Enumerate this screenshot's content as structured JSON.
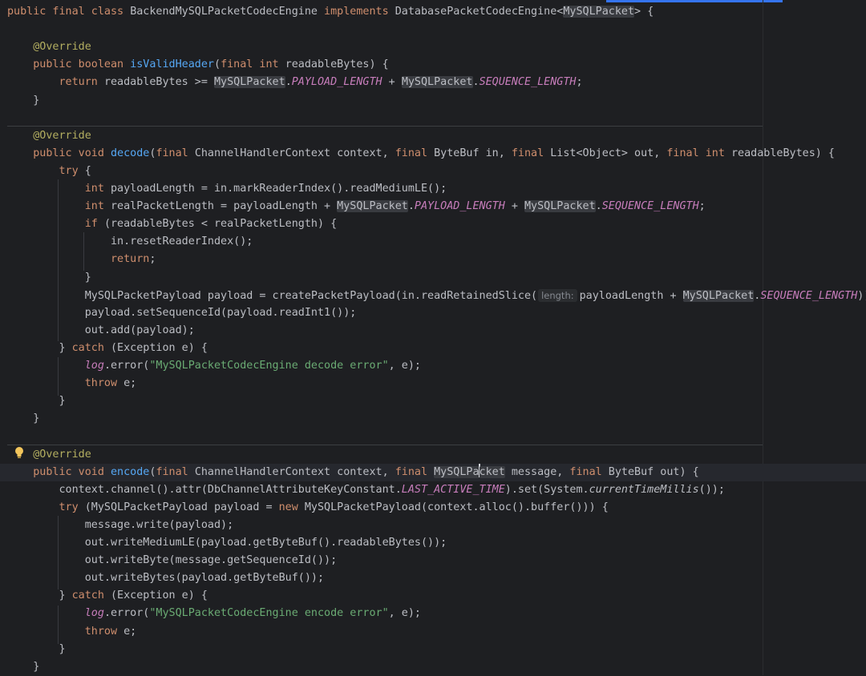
{
  "lines": [
    [
      {
        "t": "public final class ",
        "c": "kw"
      },
      {
        "t": "BackendMySQLPacketCodecEngine "
      },
      {
        "t": "implements ",
        "c": "kw"
      },
      {
        "t": "DatabasePacketCodecEngine<"
      },
      {
        "t": "MySQLPacket",
        "c": "ref"
      },
      {
        "t": "> {"
      }
    ],
    [],
    [
      {
        "t": "    "
      },
      {
        "t": "@Override",
        "c": "an"
      }
    ],
    [
      {
        "t": "    "
      },
      {
        "t": "public boolean ",
        "c": "kw"
      },
      {
        "t": "isValidHeader",
        "c": "fn"
      },
      {
        "t": "("
      },
      {
        "t": "final int ",
        "c": "kw"
      },
      {
        "t": "readableBytes) {"
      }
    ],
    [
      {
        "t": "        "
      },
      {
        "t": "return ",
        "c": "kw"
      },
      {
        "t": "readableBytes >= "
      },
      {
        "t": "MySQLPacket",
        "c": "ref"
      },
      {
        "t": "."
      },
      {
        "t": "PAYLOAD_LENGTH",
        "c": "cs"
      },
      {
        "t": " + "
      },
      {
        "t": "MySQLPacket",
        "c": "ref"
      },
      {
        "t": "."
      },
      {
        "t": "SEQUENCE_LENGTH",
        "c": "cs"
      },
      {
        "t": ";"
      }
    ],
    [
      {
        "t": "    }"
      }
    ],
    [],
    [
      {
        "t": "    "
      },
      {
        "t": "@Override",
        "c": "an"
      }
    ],
    [
      {
        "t": "    "
      },
      {
        "t": "public void ",
        "c": "kw"
      },
      {
        "t": "decode",
        "c": "fn"
      },
      {
        "t": "("
      },
      {
        "t": "final ",
        "c": "kw"
      },
      {
        "t": "ChannelHandlerContext context, "
      },
      {
        "t": "final ",
        "c": "kw"
      },
      {
        "t": "ByteBuf in, "
      },
      {
        "t": "final ",
        "c": "kw"
      },
      {
        "t": "List<Object> out, "
      },
      {
        "t": "final int ",
        "c": "kw"
      },
      {
        "t": "readableBytes) {"
      }
    ],
    [
      {
        "t": "        "
      },
      {
        "t": "try ",
        "c": "kw"
      },
      {
        "t": "{"
      }
    ],
    [
      {
        "t": "            "
      },
      {
        "t": "int ",
        "c": "kw"
      },
      {
        "t": "payloadLength = in.markReaderIndex().readMediumLE();"
      }
    ],
    [
      {
        "t": "            "
      },
      {
        "t": "int ",
        "c": "kw"
      },
      {
        "t": "realPacketLength = payloadLength + "
      },
      {
        "t": "MySQLPacket",
        "c": "ref"
      },
      {
        "t": "."
      },
      {
        "t": "PAYLOAD_LENGTH",
        "c": "cs"
      },
      {
        "t": " + "
      },
      {
        "t": "MySQLPacket",
        "c": "ref"
      },
      {
        "t": "."
      },
      {
        "t": "SEQUENCE_LENGTH",
        "c": "cs"
      },
      {
        "t": ";"
      }
    ],
    [
      {
        "t": "            "
      },
      {
        "t": "if ",
        "c": "kw"
      },
      {
        "t": "(readableBytes < realPacketLength) {"
      }
    ],
    [
      {
        "t": "                in.resetReaderIndex();"
      }
    ],
    [
      {
        "t": "                "
      },
      {
        "t": "return",
        "c": "kw"
      },
      {
        "t": ";"
      }
    ],
    [
      {
        "t": "            }"
      }
    ],
    [
      {
        "t": "            MySQLPacketPayload payload = createPacketPayload(in.readRetainedSlice("
      },
      {
        "t": "length:",
        "c": "hint"
      },
      {
        "t": "payloadLength + "
      },
      {
        "t": "MySQLPacket",
        "c": "ref"
      },
      {
        "t": "."
      },
      {
        "t": "SEQUENCE_LENGTH",
        "c": "cs"
      },
      {
        "t": "));"
      }
    ],
    [
      {
        "t": "            payload.setSequenceId(payload.readInt1());"
      }
    ],
    [
      {
        "t": "            out.add(payload);"
      }
    ],
    [
      {
        "t": "        } "
      },
      {
        "t": "catch ",
        "c": "kw"
      },
      {
        "t": "(Exception e) {"
      }
    ],
    [
      {
        "t": "            "
      },
      {
        "t": "log",
        "c": "cs"
      },
      {
        "t": ".error("
      },
      {
        "t": "\"MySQLPacketCodecEngine decode error\"",
        "c": "st"
      },
      {
        "t": ", e);"
      }
    ],
    [
      {
        "t": "            "
      },
      {
        "t": "throw ",
        "c": "kw"
      },
      {
        "t": "e;"
      }
    ],
    [
      {
        "t": "        }"
      }
    ],
    [
      {
        "t": "    }"
      }
    ],
    [],
    [
      {
        "t": "    "
      },
      {
        "t": "@Override",
        "c": "an"
      }
    ],
    [
      {
        "t": "    "
      },
      {
        "t": "public void ",
        "c": "kw"
      },
      {
        "t": "encode",
        "c": "fn"
      },
      {
        "t": "("
      },
      {
        "t": "final ",
        "c": "kw"
      },
      {
        "t": "ChannelHandlerContext context, "
      },
      {
        "t": "final ",
        "c": "kw"
      },
      {
        "t": "MySQLPa",
        "c": "ref"
      },
      {
        "t": "",
        "c": "caret"
      },
      {
        "t": "cket",
        "c": "ref"
      },
      {
        "t": " message, "
      },
      {
        "t": "final ",
        "c": "kw"
      },
      {
        "t": "ByteBuf out) {"
      }
    ],
    [
      {
        "t": "        context.channel().attr(DbChannelAttributeKeyConstant."
      },
      {
        "t": "LAST_ACTIVE_TIME",
        "c": "cs"
      },
      {
        "t": ").set(System."
      },
      {
        "t": "currentTimeMillis",
        "c": "it"
      },
      {
        "t": "());"
      }
    ],
    [
      {
        "t": "        "
      },
      {
        "t": "try ",
        "c": "kw"
      },
      {
        "t": "(MySQLPacketPayload payload = "
      },
      {
        "t": "new ",
        "c": "kw"
      },
      {
        "t": "MySQLPacketPayload(context.alloc().buffer())) {"
      }
    ],
    [
      {
        "t": "            message.write(payload);"
      }
    ],
    [
      {
        "t": "            out.writeMediumLE(payload.getByteBuf().readableBytes());"
      }
    ],
    [
      {
        "t": "            out.writeByte(message.getSequenceId());"
      }
    ],
    [
      {
        "t": "            out.writeBytes(payload.getByteBuf());"
      }
    ],
    [
      {
        "t": "        } "
      },
      {
        "t": "catch ",
        "c": "kw"
      },
      {
        "t": "(Exception e) {"
      }
    ],
    [
      {
        "t": "            "
      },
      {
        "t": "log",
        "c": "cs"
      },
      {
        "t": ".error("
      },
      {
        "t": "\"MySQLPacketCodecEngine encode error\"",
        "c": "st"
      },
      {
        "t": ", e);"
      }
    ],
    [
      {
        "t": "            "
      },
      {
        "t": "throw ",
        "c": "kw"
      },
      {
        "t": "e;"
      }
    ],
    [
      {
        "t": "        }"
      }
    ],
    [
      {
        "t": "    }"
      }
    ]
  ],
  "gutter_icon": "lightbulb-icon"
}
